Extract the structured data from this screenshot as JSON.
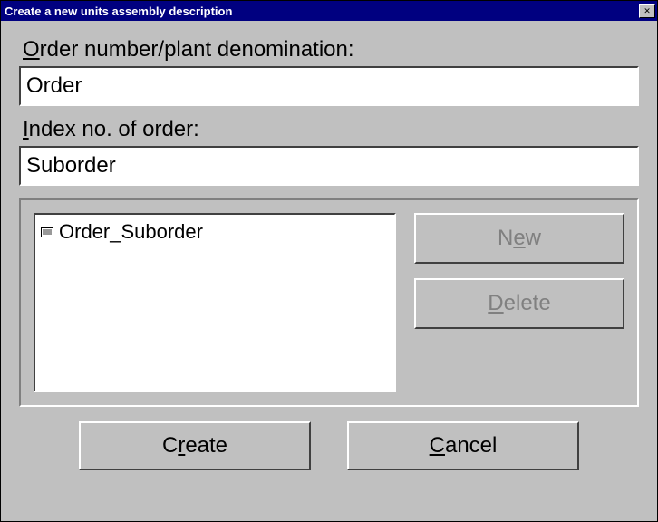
{
  "window": {
    "title": "Create a new units assembly description"
  },
  "fields": {
    "order_label_pre": "O",
    "order_label_rest": "rder number/plant denomination:",
    "order_value": "Order",
    "index_label_pre": "I",
    "index_label_rest": "ndex no. of order:",
    "index_value": "Suborder"
  },
  "list": {
    "items": [
      "Order_Suborder"
    ]
  },
  "buttons": {
    "new_pre": "N",
    "new_ul": "e",
    "new_post": "w",
    "delete_pre": "",
    "delete_ul": "D",
    "delete_post": "elete",
    "create_pre": "C",
    "create_ul": "r",
    "create_post": "eate",
    "cancel_ul": "C",
    "cancel_post": "ancel"
  },
  "colors": {
    "titlebar": "#000080",
    "surface": "#c0c0c0",
    "disabled_text": "#808080"
  }
}
